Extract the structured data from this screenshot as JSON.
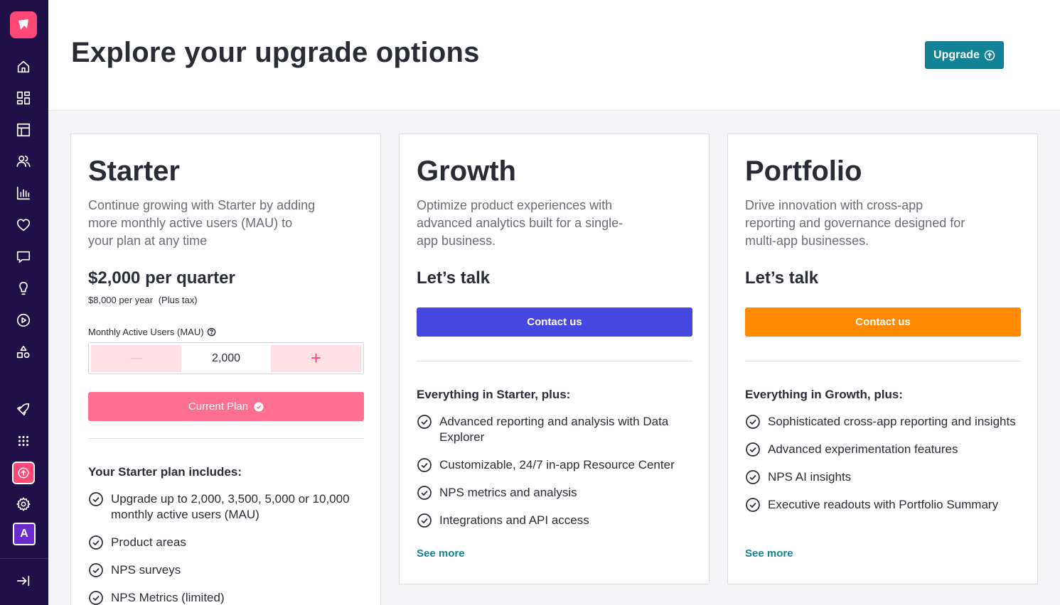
{
  "header": {
    "title": "Explore your upgrade options",
    "upgrade_label": "Upgrade"
  },
  "sidebar": {
    "items": [
      {
        "icon": "home-icon"
      },
      {
        "icon": "dashboard-icon"
      },
      {
        "icon": "layout-icon"
      },
      {
        "icon": "people-icon"
      },
      {
        "icon": "bar-chart-icon"
      },
      {
        "icon": "heart-icon"
      },
      {
        "icon": "chat-icon"
      },
      {
        "icon": "lightbulb-icon"
      },
      {
        "icon": "replay-icon"
      },
      {
        "icon": "shapes-icon"
      },
      {
        "icon": "rocket-icon"
      },
      {
        "icon": "apps-grid-icon"
      },
      {
        "icon": "upgrade-icon"
      },
      {
        "icon": "gear-icon"
      }
    ],
    "avatar": "A"
  },
  "plans": {
    "starter": {
      "name": "Starter",
      "description": "Continue growing with Starter by adding more monthly active users (MAU) to your plan at any time",
      "price": "$2,000 per quarter",
      "price_sub": "$8,000 per year",
      "tax_note": "(Plus tax)",
      "mau_label": "Monthly Active Users (MAU)",
      "mau_value": "2,000",
      "minus": "—",
      "plus": "+",
      "button": "Current Plan",
      "button_color": "#ff6f93",
      "features_title": "Your Starter plan includes:",
      "features": [
        "Upgrade up to 2,000, 3,500, 5,000 or 10,000 monthly active users (MAU)",
        "Product areas",
        "NPS surveys",
        "NPS Metrics (limited)"
      ]
    },
    "growth": {
      "name": "Growth",
      "description": "Optimize product experiences with advanced analytics built for a single-app business.",
      "price": "Let’s talk",
      "button": "Contact us",
      "button_color": "#4646e0",
      "features_title": "Everything in Starter, plus:",
      "features": [
        "Advanced reporting and analysis with Data Explorer",
        "Customizable, 24/7 in-app Resource Center",
        "NPS metrics and analysis",
        "Integrations and API access"
      ],
      "see_more": "See more"
    },
    "portfolio": {
      "name": "Portfolio",
      "description": "Drive innovation with cross-app reporting and governance designed for multi-app businesses.",
      "price": "Let’s talk",
      "button": "Contact us",
      "button_color": "#ff8a00",
      "features_title": "Everything in Growth, plus:",
      "features": [
        "Sophisticated cross-app reporting and insights",
        "Advanced experimentation features",
        "NPS AI insights",
        "Executive readouts with Portfolio Summary"
      ],
      "see_more": "See more"
    }
  },
  "colors": {
    "sidebar_bg": "#1f1048",
    "brand_pink": "#ff4876",
    "teal": "#128297"
  }
}
